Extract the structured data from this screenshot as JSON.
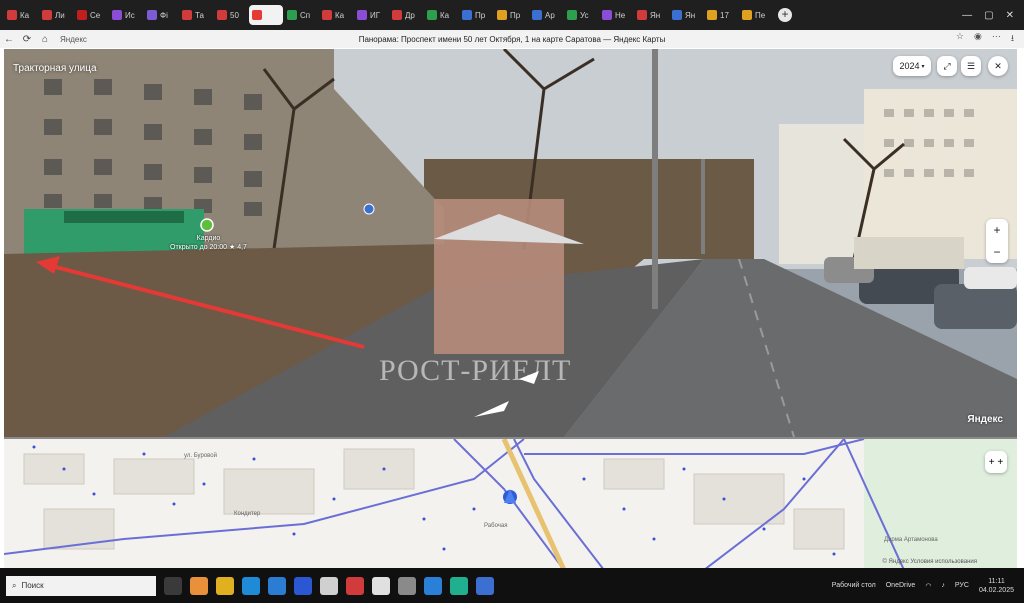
{
  "browser": {
    "tabs": [
      {
        "label": "Ка",
        "color": "#d23b3b"
      },
      {
        "label": "Ли",
        "color": "#d23b3b"
      },
      {
        "label": "Се",
        "color": "#c01f1f"
      },
      {
        "label": "Ис",
        "color": "#8c4dd6"
      },
      {
        "label": "Фі",
        "color": "#7b5bd6"
      },
      {
        "label": "Та",
        "color": "#d23b3b"
      },
      {
        "label": "50",
        "color": "#d23b3b"
      },
      {
        "label": "",
        "color": "#e53935",
        "active": true
      },
      {
        "label": "Сп",
        "color": "#2e9e4f"
      },
      {
        "label": "Ка",
        "color": "#d23b3b"
      },
      {
        "label": "ИГ",
        "color": "#8c4dd6"
      },
      {
        "label": "Др",
        "color": "#d23b3b"
      },
      {
        "label": "Ка",
        "color": "#2e9e4f"
      },
      {
        "label": "Пр",
        "color": "#3b6fd2"
      },
      {
        "label": "Пр",
        "color": "#e0a020"
      },
      {
        "label": "Ар",
        "color": "#3b6fd2"
      },
      {
        "label": "Ус",
        "color": "#2e9e4f"
      },
      {
        "label": "Не",
        "color": "#8c4dd6"
      },
      {
        "label": "Ян",
        "color": "#d23b3b"
      },
      {
        "label": "Ян",
        "color": "#3b6fd2"
      },
      {
        "label": "17",
        "color": "#e0a020"
      },
      {
        "label": "Пе",
        "color": "#e0a020"
      }
    ],
    "url_domain": "Яндекс",
    "page_title": "Панорама: Проспект имени 50 лет Октября, 1 на карте Саратова — Яндекс Карты"
  },
  "panorama": {
    "street_label": "Тракторная улица",
    "poi_name": "Кардио",
    "poi_hours": "Открыто до 20:00  ★ 4,7",
    "watermark": "РОСТ-РИЕЛТ",
    "year": "2024",
    "brand": "Яндекс",
    "zoom_in": "+",
    "zoom_out": "−",
    "close": "✕",
    "fullscreen": "⤢",
    "menu": "☰",
    "arrow_color": "#e53935"
  },
  "map": {
    "zoom_label": "+ +",
    "labels": [
      "ул. Буровой",
      "Кондитер",
      "Дарма Артамонова",
      "Рабочая"
    ],
    "copyright": "© Яндекс  Условия использования"
  },
  "taskbar": {
    "search_label": "Поиск",
    "tray_desktop": "Рабочий стол",
    "tray_onedrive": "OneDrive",
    "lang": "РУС",
    "time": "11:11",
    "date": "04.02.2025"
  }
}
